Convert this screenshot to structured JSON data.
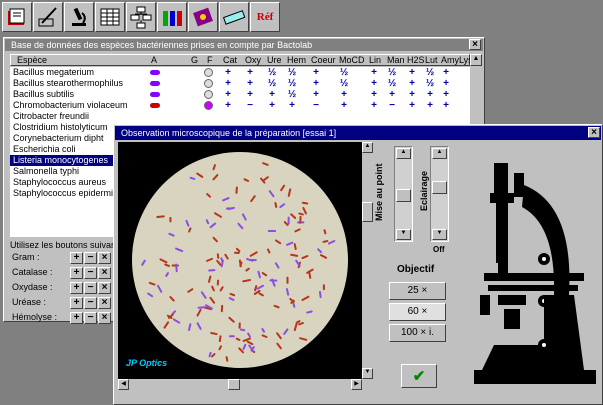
{
  "toolbar": {
    "icons": [
      "book-icon",
      "pen-icon",
      "microscope-icon",
      "table-icon",
      "tree-icon",
      "flasks-icon",
      "notebook-icon",
      "slide-icon",
      "reference-icon"
    ],
    "ref_label": "Réf"
  },
  "db_window": {
    "title": "Base de données des espèces bactériennes prises en compte par Bactolab",
    "close": "×",
    "columns": [
      "Espèce",
      "A",
      "G",
      "F",
      "Cat",
      "Oxy",
      "Ure",
      "Hem",
      "Coeur",
      "MoCD",
      "Lin",
      "Man",
      "H2S",
      "Lut",
      "Amy",
      "Lys"
    ],
    "species": [
      "Bacillus megaterium",
      "Bacillus stearothermophilus",
      "Bacillus subtilis",
      "Chromobacterium violaceum",
      "Citrobacter freundii",
      "Clostridium histolyticum",
      "Corynebacterium dipht",
      "Escherichia coli",
      "Listeria monocytogenes",
      "Salmonella typhi",
      "Staphylococcus aureus",
      "Staphylococcus epidermidis"
    ],
    "selected_index": 8,
    "row_cells": [
      [
        "+",
        "+",
        "½",
        "½",
        "+",
        "½",
        "+",
        "½",
        "+",
        "½",
        "+"
      ],
      [
        "+",
        "+",
        "½",
        "½",
        "+",
        "½",
        "+",
        "½",
        "+",
        "½",
        "+"
      ],
      [
        "+",
        "+",
        "+",
        "½",
        "+",
        "+",
        "+",
        "+",
        "+",
        "+",
        "+"
      ],
      [
        "+",
        "−",
        "+",
        "+",
        "−",
        "+",
        "+",
        "−",
        "+",
        "+",
        "+"
      ]
    ],
    "buttons_hint": "Utilisez les boutons suivants :",
    "tests": [
      "Gram :",
      "Catalase :",
      "Oxydase :",
      "Uréase :",
      "Hémolyse :"
    ],
    "plus": "+",
    "minus": "−",
    "x": "×"
  },
  "obs_window": {
    "title": "Observation microscopique de la préparation [essai 1]",
    "close": "×",
    "brand": "JP Optics",
    "focus_label": "Mise au point",
    "lighting_label": "Eclairage",
    "off_label": "Off",
    "objective_title": "Objectif",
    "objectives": [
      "25 ×",
      "60 ×",
      "100 × i."
    ],
    "selected_objective": 1,
    "ok_symbol": "✔"
  },
  "colors": {
    "desktop": "#808080",
    "face": "#c0c0c0",
    "title_bar": "#000080",
    "field": "#d8d4c0",
    "rod": "#b5361b",
    "violet": "#8c4ee0"
  }
}
